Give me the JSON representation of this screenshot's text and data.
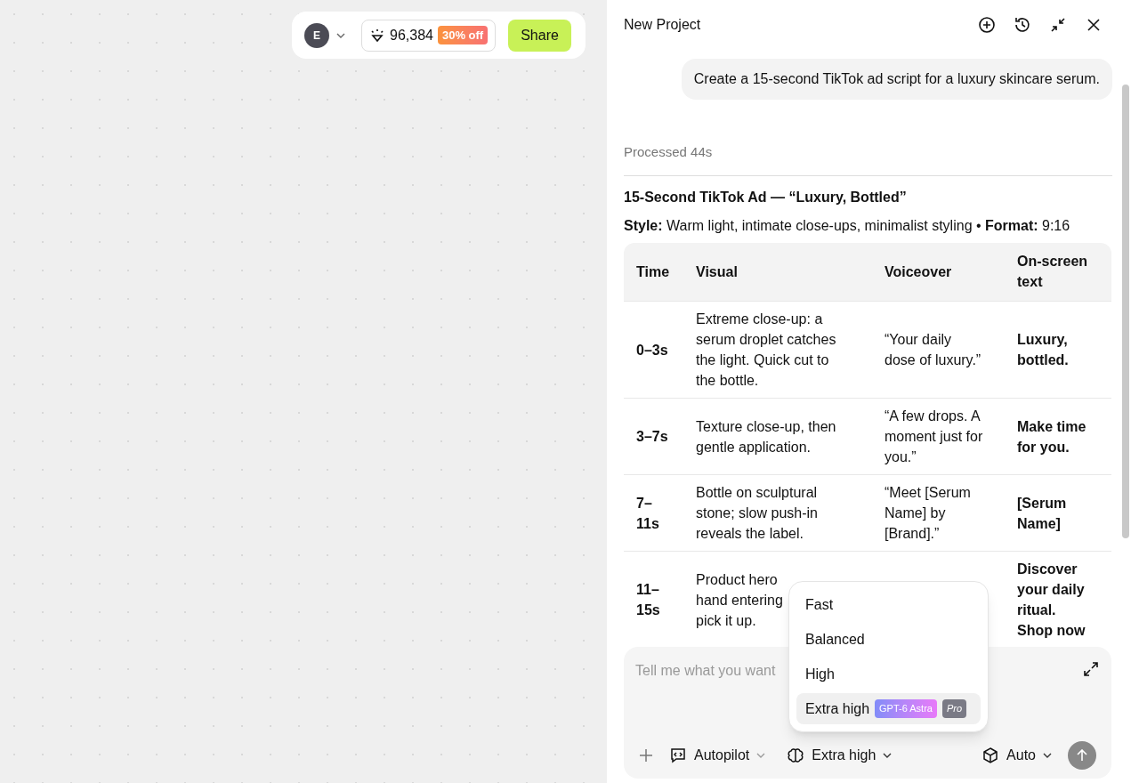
{
  "toolbar": {
    "avatar_letter": "E",
    "credits": "96,384",
    "discount": "30% off",
    "share": "Share"
  },
  "panel": {
    "title": "New Project"
  },
  "chat": {
    "user_message": "Create a 15-second TikTok ad script for a luxury skincare serum.",
    "processed": "Processed 44s",
    "heading": "15-Second TikTok Ad — “Luxury, Bottled”",
    "style_line": "**Style:** Warm light, intimate close-ups, minimalist styling • **Format:** 9:16"
  },
  "table": {
    "columns": [
      "Time",
      "Visual",
      "Voiceover",
      "On-screen text"
    ],
    "rows": [
      [
        "0–3s",
        "Extreme close-up: a serum droplet catches the light. Quick cut to the bottle.",
        "“Your daily dose of luxury.”",
        "Luxury, bottled."
      ],
      [
        "3–7s",
        "Texture close-up, then gentle application.",
        "“A few drops. A moment just for you.”",
        "Make time for you."
      ],
      [
        "7–11s",
        "Bottle on sculptural stone; slow push-in reveals the label.",
        "“Meet [Serum Name] by [Brand].”",
        "[Serum Name]"
      ],
      [
        "11–15s",
        "Product hero\nhand entering\npick it up.",
        "",
        "Discover your daily ritual.\nShop now"
      ]
    ]
  },
  "composer": {
    "placeholder": "Tell me what you want",
    "mode": "Autopilot",
    "reasoning": "Extra high",
    "model": "Auto"
  },
  "reasoning_menu": {
    "items": [
      {
        "label": "Fast",
        "selected": false
      },
      {
        "label": "Balanced",
        "selected": false
      },
      {
        "label": "High",
        "selected": false
      },
      {
        "label": "Extra high",
        "selected": true,
        "badges": [
          "GPT-6 Astra",
          "Pro"
        ]
      }
    ]
  }
}
